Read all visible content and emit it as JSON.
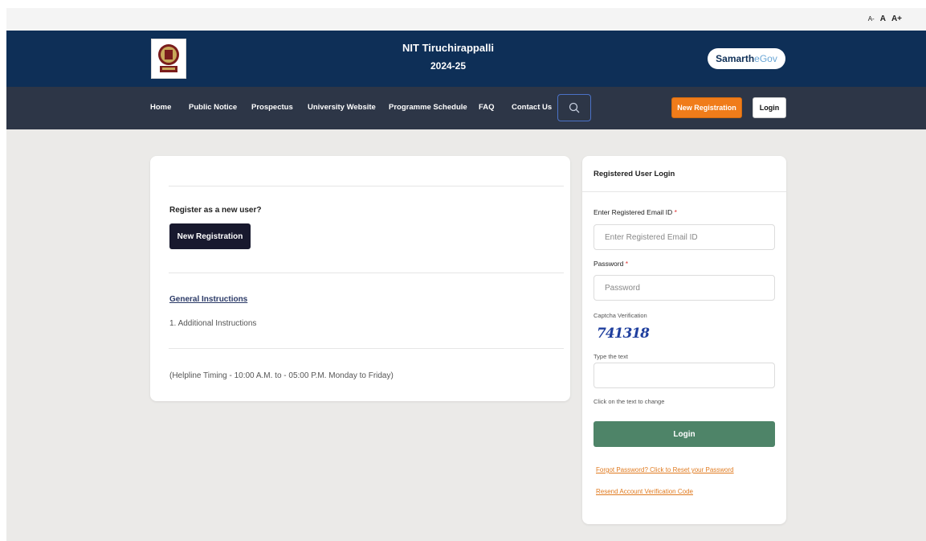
{
  "font_size_controls": [
    "A-",
    "A",
    "A+"
  ],
  "header": {
    "institute_name": "NIT Tiruchirappalli",
    "academic_year": "2024-25",
    "brand_prefix": "Samarth",
    "brand_suffix": "eGov",
    "logo_icon": "institute-emblem-icon"
  },
  "nav": {
    "items": [
      "Home",
      "Public Notice",
      "Prospectus",
      "University Website",
      "Programme Schedule",
      "FAQ",
      "Contact Us"
    ],
    "search_icon": "search-icon",
    "new_registration_label": "New Registration",
    "login_label": "Login"
  },
  "left_card": {
    "register_prompt": "Register as a new user?",
    "new_registration_button": "New Registration",
    "general_instructions_heading": "General Instructions",
    "instruction_1": "1. Additional Instructions",
    "helpline": "(Helpline Timing - 10:00 A.M. to - 05:00 P.M. Monday to Friday)"
  },
  "login_card": {
    "heading": "Registered User Login",
    "email_label": "Enter Registered Email ID",
    "email_placeholder": "Enter Registered Email ID",
    "password_label": "Password",
    "password_placeholder": "Password",
    "required_marker": "*",
    "captcha_label": "Captcha Verification",
    "captcha_text": "741318",
    "type_text_label": "Type the text",
    "captcha_hint": "Click on the text to change",
    "login_button": "Login",
    "forgot_password_link": "Forgot Password? Click to Reset your Password",
    "resend_link": "Resend Account Verification Code"
  },
  "colors": {
    "header_bg": "#0e2f57",
    "navbar_bg": "#2d3647",
    "accent_orange": "#f07c1a",
    "login_green": "#4e8468",
    "dark_button": "#18192e"
  }
}
